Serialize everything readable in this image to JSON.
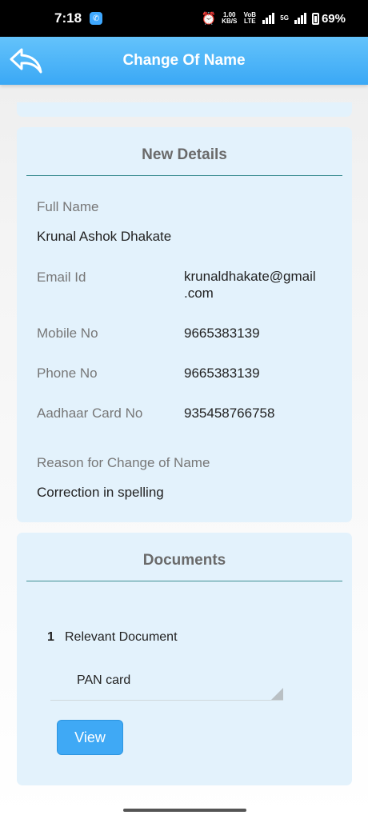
{
  "status_bar": {
    "time": "7:18",
    "net_speed_value": "1.00",
    "net_speed_unit": "KB/S",
    "volte": "VoB LTE",
    "network": "5G",
    "battery": "69%"
  },
  "header": {
    "title": "Change Of Name",
    "back_icon": "back-arrow-icon"
  },
  "new_details": {
    "title": "New Details",
    "full_name_label": "Full Name",
    "full_name_value": "Krunal Ashok Dhakate",
    "email_label": "Email Id",
    "email_value_line1": "krunaldhakate@gmail",
    "email_value_line2": ".com",
    "mobile_label": "Mobile No",
    "mobile_value": "9665383139",
    "phone_label": "Phone No",
    "phone_value": "9665383139",
    "aadhaar_label": "Aadhaar Card No",
    "aadhaar_value": "935458766758",
    "reason_label": "Reason for Change of Name",
    "reason_value": "Correction in spelling"
  },
  "documents": {
    "title": "Documents",
    "items": [
      {
        "number": "1",
        "label": "Relevant Document",
        "selected": "PAN card",
        "button_label": "View"
      }
    ]
  },
  "colors": {
    "header_blue": "#3aa8f5",
    "card_bg": "#e3f2fc",
    "divider": "#3e8f93",
    "button_blue": "#3fa9f5"
  }
}
